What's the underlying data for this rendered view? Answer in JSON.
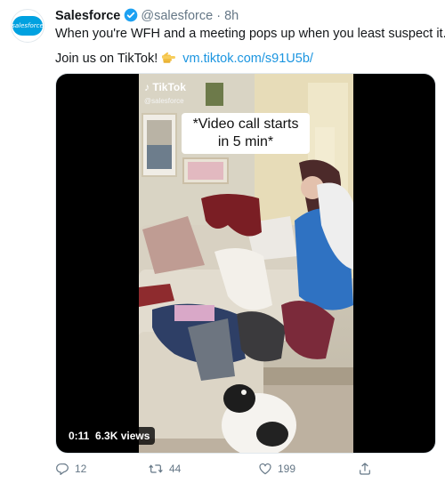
{
  "author": {
    "name": "Salesforce",
    "handle": "@salesforce",
    "separator": "·",
    "time": "8h",
    "avatar_text": "salesforce"
  },
  "tweet": {
    "line1": "When you're WFH and a meeting pops up when you least suspect it...",
    "line2_text": "Join us on TikTok!",
    "link": "vm.tiktok.com/s91U5b/"
  },
  "video": {
    "watermark_logo": "TikTok",
    "watermark_handle": "@salesforce",
    "caption_line1": "*Video call starts",
    "caption_line2": "in 5 min*",
    "duration": "0:11",
    "views": "6.3K views"
  },
  "actions": {
    "replies": "12",
    "retweets": "44",
    "likes": "199"
  },
  "colors": {
    "link": "#1b95e0",
    "verified": "#1da1f2",
    "brand": "#00a1e0",
    "muted": "#657786"
  },
  "icons": [
    "verified-badge-icon",
    "pointing-hand-icon",
    "reply-icon",
    "retweet-icon",
    "like-icon",
    "share-icon",
    "tiktok-icon"
  ]
}
